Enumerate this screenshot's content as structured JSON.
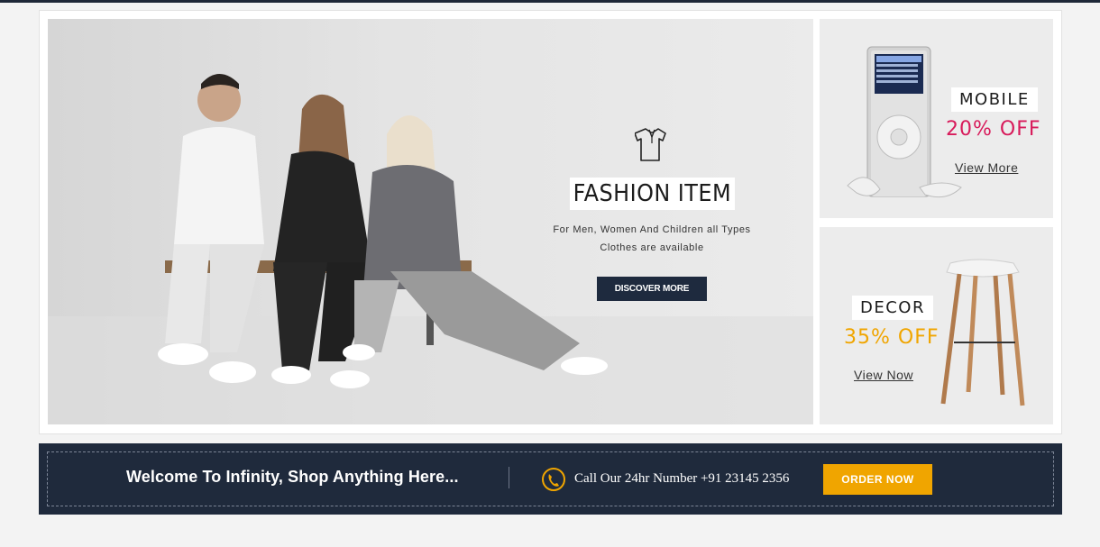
{
  "hero": {
    "icon": "tshirt-icon",
    "title": "FASHION ITEM",
    "subtitle_line1": "For Men, Women And Children all Types",
    "subtitle_line2": "Clothes are available",
    "button_label": "DISCOVER MORE"
  },
  "cards": {
    "mobile": {
      "label": "MOBILE",
      "offer": "20% OFF",
      "offer_color": "#d81b5b",
      "link": "View More"
    },
    "decor": {
      "label": "DECOR",
      "offer": "35% OFF",
      "offer_color": "#f0a500",
      "link": "View Now"
    }
  },
  "promo": {
    "welcome": "Welcome To Infinity, Shop Anything Here...",
    "call_text": "Call Our 24hr Number +91 23145 2356",
    "phone_icon": "phone-icon",
    "button_label": "ORDER NOW"
  },
  "colors": {
    "navy": "#1f2a3c",
    "accent_yellow": "#f0a500",
    "accent_pink": "#d81b5b"
  }
}
